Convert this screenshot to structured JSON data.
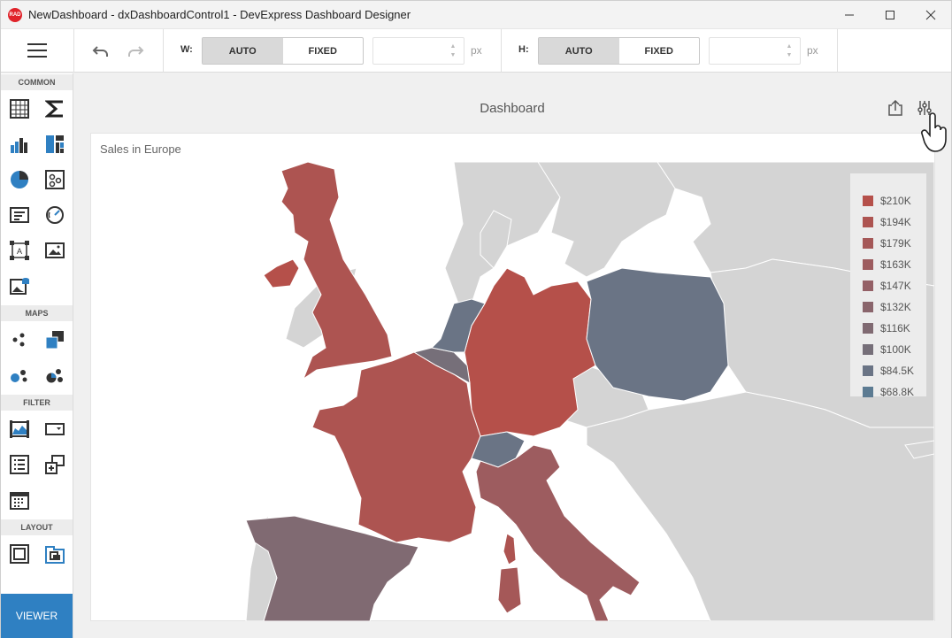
{
  "window": {
    "title": "NewDashboard - dxDashboardControl1 - DevExpress Dashboard Designer",
    "app_icon_text": "RAD"
  },
  "toolbar": {
    "width_label": "W:",
    "height_label": "H:",
    "width_mode": {
      "auto": "AUTO",
      "fixed": "FIXED",
      "selected": "AUTO"
    },
    "height_mode": {
      "auto": "AUTO",
      "fixed": "FIXED",
      "selected": "AUTO"
    },
    "width_value": "",
    "height_value": "",
    "unit": "px"
  },
  "sidebar": {
    "sections": [
      {
        "header": "COMMON",
        "items": [
          "grid-icon",
          "card-sum-icon",
          "chart-icon",
          "treemap-icon",
          "pie-icon",
          "scatter-icon",
          "text-box-icon",
          "gauge-icon",
          "bound-image-icon",
          "image-icon",
          "image-data-icon"
        ]
      },
      {
        "header": "MAPS",
        "items": [
          "geo-point-map-icon",
          "choropleth-map-icon",
          "bubble-map-icon",
          "pie-map-icon"
        ]
      },
      {
        "header": "FILTER",
        "items": [
          "range-filter-icon",
          "combo-box-icon",
          "list-box-icon",
          "tree-view-icon",
          "date-filter-icon"
        ]
      },
      {
        "header": "LAYOUT",
        "items": [
          "group-icon",
          "tab-container-icon"
        ]
      }
    ],
    "viewer_label": "VIEWER"
  },
  "dashboard": {
    "title": "Dashboard",
    "item_title": "Sales in Europe",
    "legend": [
      {
        "label": "$210K",
        "color": "#b5504a"
      },
      {
        "label": "$194K",
        "color": "#ad5451"
      },
      {
        "label": "$179K",
        "color": "#a55858"
      },
      {
        "label": "$163K",
        "color": "#9d5c5f"
      },
      {
        "label": "$147K",
        "color": "#946066"
      },
      {
        "label": "$132K",
        "color": "#8a656c"
      },
      {
        "label": "$116K",
        "color": "#806a72"
      },
      {
        "label": "$100K",
        "color": "#766f79"
      },
      {
        "label": "$84.5K",
        "color": "#6a7485"
      },
      {
        "label": "$68.8K",
        "color": "#5c7b92"
      }
    ],
    "colors": {
      "land_no_data": "#d4d4d4",
      "sea": "#ffffff",
      "accent": "#2f80c2"
    }
  }
}
